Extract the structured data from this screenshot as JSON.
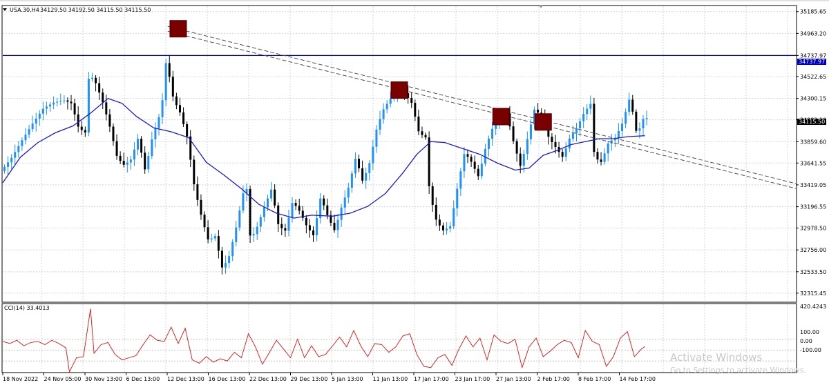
{
  "header": {
    "symbol": "USA.30,H4",
    "ohlc": "34129.50 34192.50 34115.50 34115.50"
  },
  "indicator": {
    "label": "CCI(14) 33.4013",
    "top_value": "420.4243",
    "levels": [
      "100.00",
      "0.00",
      "-100.00"
    ]
  },
  "price_axis": {
    "labels": [
      "35185.65",
      "34963.20",
      "34737.97",
      "34522.65",
      "34300.15",
      "34082.10",
      "33859.60",
      "33641.55",
      "33419.05",
      "33196.55",
      "32978.50",
      "32756.00",
      "32533.50",
      "32315.45"
    ]
  },
  "price_tags": {
    "horizontal_line": "34737.97",
    "current_price": "34115.50"
  },
  "time_axis": {
    "labels": [
      "18 Nov 2022",
      "24 Nov 05:00",
      "30 Nov 13:00",
      "6 Dec 13:00",
      "12 Dec 13:00",
      "16 Dec 13:00",
      "22 Dec 13:00",
      "29 Dec 13:00",
      "5 Jan 13:00",
      "11 Jan 13:00",
      "17 Jan 17:00",
      "23 Jan 17:00",
      "27 Jan 13:00",
      "2 Feb 17:00",
      "8 Feb 17:00",
      "14 Feb 17:00"
    ]
  },
  "watermark": {
    "title": "Activate Windows",
    "subtitle": "Go to Settings to activate Windows."
  },
  "chart_data": {
    "type": "line",
    "title": "USA.30,H4",
    "x_labels": [
      "18 Nov 2022",
      "24 Nov 05:00",
      "30 Nov 13:00",
      "6 Dec 13:00",
      "12 Dec 13:00",
      "16 Dec 13:00",
      "22 Dec 13:00",
      "29 Dec 13:00",
      "5 Jan 13:00",
      "11 Jan 13:00",
      "17 Jan 17:00",
      "23 Jan 17:00",
      "27 Jan 13:00",
      "2 Feb 17:00",
      "8 Feb 17:00",
      "14 Feb 17:00"
    ],
    "ylim": [
      32230,
      35240
    ],
    "price_close": [
      [
        0,
        33560
      ],
      [
        3,
        33700
      ],
      [
        6,
        33880
      ],
      [
        9,
        34050
      ],
      [
        12,
        34200
      ],
      [
        15,
        34260
      ],
      [
        18,
        34280
      ],
      [
        20,
        34250
      ],
      [
        22,
        34000
      ],
      [
        24,
        33950
      ],
      [
        25,
        34560
      ],
      [
        27,
        34450
      ],
      [
        29,
        34250
      ],
      [
        31,
        34000
      ],
      [
        33,
        33700
      ],
      [
        35,
        33620
      ],
      [
        37,
        33680
      ],
      [
        39,
        33900
      ],
      [
        41,
        33560
      ],
      [
        43,
        33900
      ],
      [
        45,
        34120
      ],
      [
        46,
        34300
      ],
      [
        47,
        34700
      ],
      [
        49,
        34300
      ],
      [
        51,
        34150
      ],
      [
        53,
        33900
      ],
      [
        55,
        33400
      ],
      [
        57,
        33100
      ],
      [
        59,
        32850
      ],
      [
        61,
        32900
      ],
      [
        63,
        32560
      ],
      [
        65,
        32700
      ],
      [
        67,
        33000
      ],
      [
        69,
        33350
      ],
      [
        70,
        33380
      ],
      [
        71,
        32850
      ],
      [
        73,
        33000
      ],
      [
        75,
        33200
      ],
      [
        77,
        33380
      ],
      [
        79,
        33000
      ],
      [
        81,
        32950
      ],
      [
        83,
        33250
      ],
      [
        85,
        33150
      ],
      [
        87,
        33000
      ],
      [
        89,
        32900
      ],
      [
        91,
        33300
      ],
      [
        93,
        33100
      ],
      [
        95,
        32950
      ],
      [
        97,
        33200
      ],
      [
        99,
        33400
      ],
      [
        101,
        33700
      ],
      [
        103,
        33450
      ],
      [
        105,
        33650
      ],
      [
        107,
        34000
      ],
      [
        109,
        34200
      ],
      [
        111,
        34300
      ],
      [
        113,
        34400
      ],
      [
        115,
        34350
      ],
      [
        117,
        34250
      ],
      [
        119,
        33950
      ],
      [
        121,
        33900
      ],
      [
        122,
        33350
      ],
      [
        124,
        33050
      ],
      [
        126,
        32950
      ],
      [
        128,
        33000
      ],
      [
        130,
        33400
      ],
      [
        132,
        33750
      ],
      [
        134,
        33650
      ],
      [
        136,
        33500
      ],
      [
        138,
        33800
      ],
      [
        140,
        34000
      ],
      [
        142,
        34100
      ],
      [
        144,
        34150
      ],
      [
        146,
        33850
      ],
      [
        148,
        33600
      ],
      [
        150,
        33900
      ],
      [
        152,
        34200
      ],
      [
        154,
        34100
      ],
      [
        156,
        33900
      ],
      [
        158,
        33800
      ],
      [
        160,
        33700
      ],
      [
        162,
        33900
      ],
      [
        164,
        34000
      ],
      [
        166,
        34150
      ],
      [
        168,
        34250
      ],
      [
        169,
        33700
      ],
      [
        171,
        33650
      ],
      [
        173,
        33850
      ],
      [
        175,
        33900
      ],
      [
        177,
        34050
      ],
      [
        179,
        34300
      ],
      [
        180,
        34150
      ],
      [
        181,
        33950
      ],
      [
        182,
        34000
      ],
      [
        183,
        34100
      ]
    ],
    "ma_line": [
      [
        0,
        33440
      ],
      [
        5,
        33700
      ],
      [
        10,
        33850
      ],
      [
        15,
        33950
      ],
      [
        20,
        34020
      ],
      [
        25,
        34150
      ],
      [
        30,
        34300
      ],
      [
        34,
        34250
      ],
      [
        38,
        34120
      ],
      [
        43,
        34000
      ],
      [
        48,
        33960
      ],
      [
        53,
        33900
      ],
      [
        58,
        33650
      ],
      [
        63,
        33520
      ],
      [
        68,
        33380
      ],
      [
        73,
        33220
      ],
      [
        78,
        33130
      ],
      [
        83,
        33080
      ],
      [
        88,
        33110
      ],
      [
        94,
        33100
      ],
      [
        99,
        33130
      ],
      [
        104,
        33200
      ],
      [
        109,
        33330
      ],
      [
        114,
        33540
      ],
      [
        118,
        33730
      ],
      [
        122,
        33860
      ],
      [
        126,
        33850
      ],
      [
        131,
        33790
      ],
      [
        136,
        33730
      ],
      [
        141,
        33640
      ],
      [
        146,
        33570
      ],
      [
        150,
        33590
      ],
      [
        154,
        33720
      ],
      [
        158,
        33770
      ],
      [
        162,
        33830
      ],
      [
        166,
        33860
      ],
      [
        170,
        33890
      ],
      [
        174,
        33890
      ],
      [
        178,
        33910
      ],
      [
        183,
        33920
      ]
    ],
    "horizontal_line": 34737.97,
    "trendlines": [
      {
        "x1": 47,
        "y1": 35035,
        "x2": 226,
        "y2": 33432
      },
      {
        "x1": 47,
        "y1": 34985,
        "x2": 226,
        "y2": 33382
      }
    ],
    "markers": [
      {
        "x": 50,
        "y": 35010
      },
      {
        "x": 113,
        "y": 34385
      },
      {
        "x": 142,
        "y": 34115
      },
      {
        "x": 154,
        "y": 34060
      }
    ],
    "cci": {
      "name": "CCI(14)",
      "value": "33.4013",
      "levels": [
        100,
        0,
        -100
      ],
      "ylim": [
        -200,
        420.4243
      ],
      "values": [
        [
          0,
          80
        ],
        [
          2,
          60
        ],
        [
          4,
          90
        ],
        [
          6,
          40
        ],
        [
          8,
          70
        ],
        [
          10,
          80
        ],
        [
          12,
          50
        ],
        [
          14,
          90
        ],
        [
          16,
          60
        ],
        [
          18,
          20
        ],
        [
          19,
          -200
        ],
        [
          21,
          -70
        ],
        [
          23,
          -60
        ],
        [
          25,
          380
        ],
        [
          26,
          -30
        ],
        [
          28,
          50
        ],
        [
          30,
          70
        ],
        [
          32,
          -40
        ],
        [
          34,
          -90
        ],
        [
          36,
          -70
        ],
        [
          38,
          -50
        ],
        [
          40,
          50
        ],
        [
          42,
          140
        ],
        [
          44,
          90
        ],
        [
          46,
          80
        ],
        [
          48,
          210
        ],
        [
          50,
          60
        ],
        [
          52,
          200
        ],
        [
          54,
          -90
        ],
        [
          56,
          -120
        ],
        [
          58,
          -60
        ],
        [
          60,
          -110
        ],
        [
          62,
          -80
        ],
        [
          64,
          -100
        ],
        [
          66,
          -20
        ],
        [
          68,
          -70
        ],
        [
          70,
          150
        ],
        [
          72,
          30
        ],
        [
          74,
          -130
        ],
        [
          76,
          -20
        ],
        [
          78,
          90
        ],
        [
          80,
          10
        ],
        [
          82,
          -70
        ],
        [
          84,
          100
        ],
        [
          86,
          -70
        ],
        [
          88,
          40
        ],
        [
          90,
          -60
        ],
        [
          92,
          -40
        ],
        [
          94,
          40
        ],
        [
          96,
          120
        ],
        [
          98,
          30
        ],
        [
          100,
          180
        ],
        [
          102,
          40
        ],
        [
          104,
          -60
        ],
        [
          106,
          60
        ],
        [
          108,
          50
        ],
        [
          110,
          -20
        ],
        [
          112,
          30
        ],
        [
          114,
          130
        ],
        [
          116,
          150
        ],
        [
          118,
          -40
        ],
        [
          120,
          -150
        ],
        [
          122,
          -160
        ],
        [
          124,
          -70
        ],
        [
          126,
          -40
        ],
        [
          128,
          -140
        ],
        [
          130,
          10
        ],
        [
          132,
          130
        ],
        [
          134,
          30
        ],
        [
          136,
          110
        ],
        [
          138,
          -90
        ],
        [
          140,
          140
        ],
        [
          142,
          80
        ],
        [
          144,
          60
        ],
        [
          146,
          100
        ],
        [
          148,
          -160
        ],
        [
          150,
          30
        ],
        [
          152,
          110
        ],
        [
          154,
          -60
        ],
        [
          156,
          -10
        ],
        [
          158,
          50
        ],
        [
          160,
          90
        ],
        [
          162,
          70
        ],
        [
          164,
          -70
        ],
        [
          166,
          180
        ],
        [
          168,
          80
        ],
        [
          170,
          50
        ],
        [
          172,
          -150
        ],
        [
          174,
          -60
        ],
        [
          176,
          110
        ],
        [
          178,
          170
        ],
        [
          180,
          -60
        ],
        [
          182,
          10
        ],
        [
          183,
          33
        ]
      ]
    }
  }
}
